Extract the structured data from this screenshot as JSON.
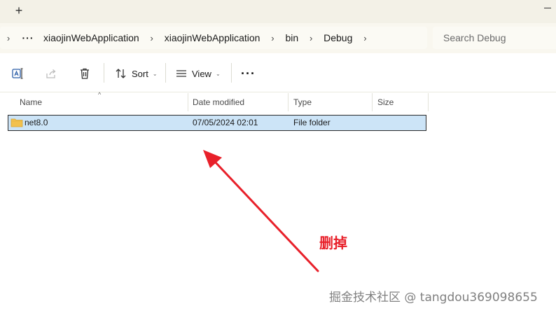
{
  "tabstrip": {
    "new_tab_glyph": "+"
  },
  "address": {
    "overflow_glyph": "···",
    "crumbs": [
      "xiaojinWebApplication",
      "xiaojinWebApplication",
      "bin",
      "Debug"
    ],
    "search_placeholder": "Search Debug"
  },
  "toolbar": {
    "sort_label": "Sort",
    "view_label": "View",
    "more_glyph": "···"
  },
  "columns": {
    "sort_glyph": "^",
    "name": "Name",
    "date": "Date modified",
    "type": "Type",
    "size": "Size"
  },
  "files": [
    {
      "name": "net8.0",
      "date": "07/05/2024 02:01",
      "type": "File folder",
      "size": ""
    }
  ],
  "annotation": {
    "text": "删掉",
    "color": "#e8202a"
  },
  "watermark": "掘金技术社区 @ tangdou369098655",
  "colors": {
    "selection": "#cce4f7",
    "folder": "#f2c14e",
    "accent": "#e8202a"
  }
}
